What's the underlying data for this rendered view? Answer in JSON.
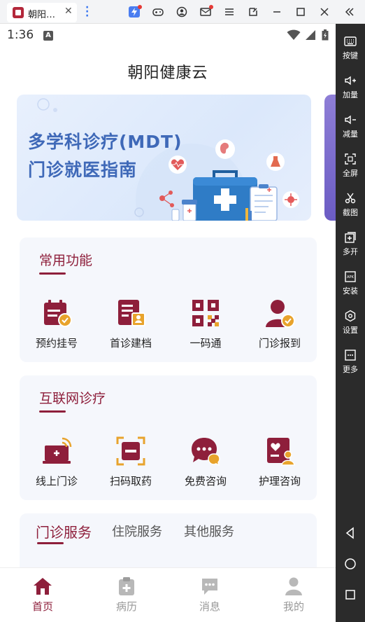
{
  "emulator": {
    "tab_title": "朝阳…",
    "tab_close": "✕",
    "rail": [
      {
        "icon": "keyboard-icon",
        "label": "按键"
      },
      {
        "icon": "volume-up-icon",
        "label": "加量"
      },
      {
        "icon": "volume-down-icon",
        "label": "减量"
      },
      {
        "icon": "fullscreen-icon",
        "label": "全屏"
      },
      {
        "icon": "scissors-icon",
        "label": "截图"
      },
      {
        "icon": "multi-open-icon",
        "label": "多开"
      },
      {
        "icon": "apk-icon",
        "label": "安装"
      },
      {
        "icon": "settings-icon",
        "label": "设置"
      },
      {
        "icon": "more-icon",
        "label": "更多"
      }
    ]
  },
  "status_bar": {
    "time": "1:36",
    "badge": "A"
  },
  "app": {
    "title": "朝阳健康云"
  },
  "banner": {
    "line1": "多学科诊疗(MDT)",
    "line2": "门诊就医指南"
  },
  "common_functions": {
    "title": "常用功能",
    "items": [
      {
        "label": "预约挂号",
        "icon": "calendar-check-icon"
      },
      {
        "label": "首诊建档",
        "icon": "record-profile-icon"
      },
      {
        "label": "一码通",
        "icon": "qr-code-icon"
      },
      {
        "label": "门诊报到",
        "icon": "user-check-icon"
      }
    ]
  },
  "internet_clinic": {
    "title": "互联网诊疗",
    "items": [
      {
        "label": "线上门诊",
        "icon": "online-clinic-icon"
      },
      {
        "label": "扫码取药",
        "icon": "scan-medicine-icon"
      },
      {
        "label": "免费咨询",
        "icon": "chat-bubble-icon"
      },
      {
        "label": "护理咨询",
        "icon": "nursing-consult-icon"
      }
    ]
  },
  "service_tabs": [
    "门诊服务",
    "住院服务",
    "其他服务"
  ],
  "bottom_nav": [
    {
      "label": "首页",
      "icon": "home-icon"
    },
    {
      "label": "病历",
      "icon": "medical-record-icon"
    },
    {
      "label": "消息",
      "icon": "message-icon"
    },
    {
      "label": "我的",
      "icon": "profile-icon"
    }
  ],
  "colors": {
    "brand": "#8e1f3b",
    "accent_orange": "#e8a32c",
    "banner_text": "#3f69b8"
  }
}
